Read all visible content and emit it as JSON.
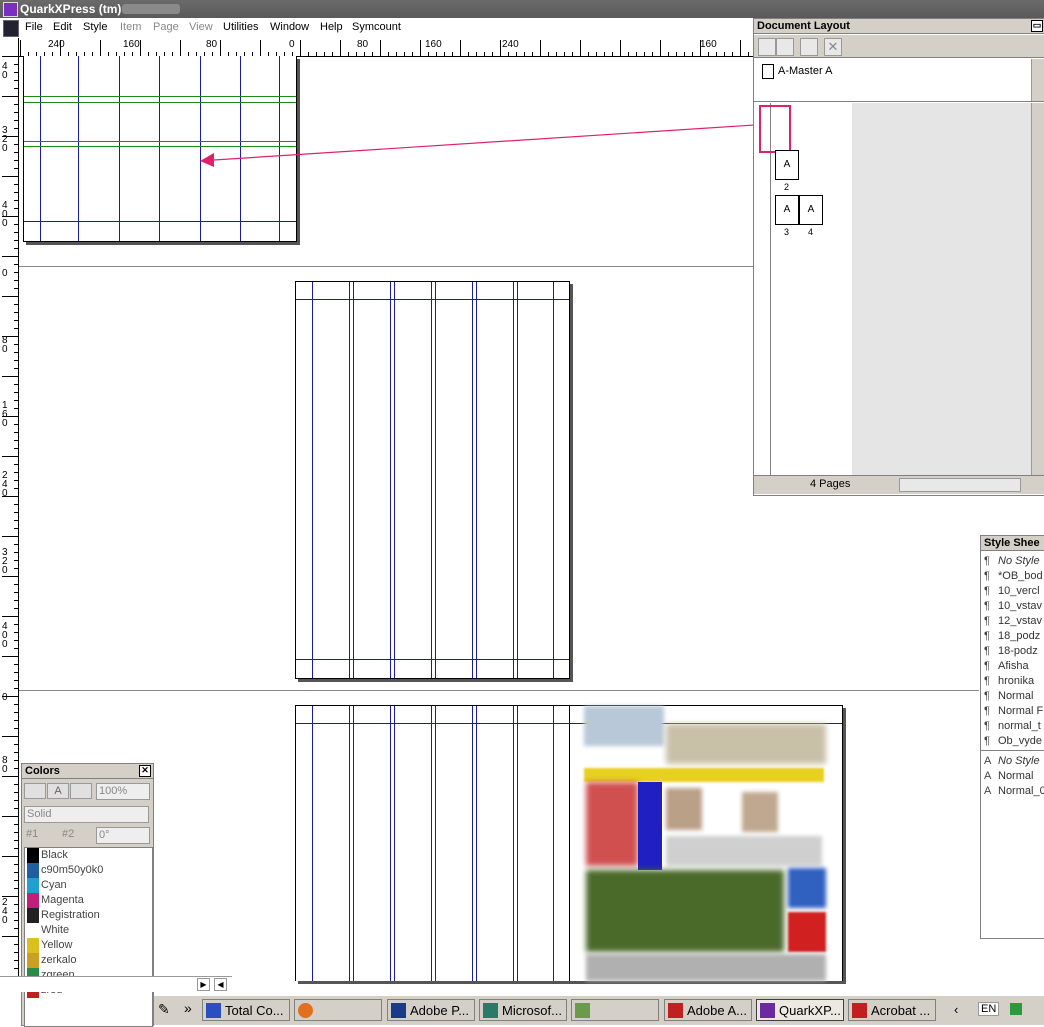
{
  "app": {
    "title": "QuarkXPress (tm)"
  },
  "menu": [
    "File",
    "Edit",
    "Style",
    "Item",
    "Page",
    "View",
    "Utilities",
    "Window",
    "Help",
    "Symcount"
  ],
  "ruler": {
    "h_labels": [
      "240",
      "160",
      "80",
      "0",
      "80",
      "160",
      "240",
      "160"
    ],
    "v_labels": [
      "4\n0",
      "3\n2\n0",
      "4\n0\n0",
      "0",
      "8\n0",
      "1\n6\n0",
      "2\n4\n0",
      "3\n2\n0",
      "4\n0\n0",
      "0",
      "8\n0",
      "2\n4\n0"
    ]
  },
  "document_layout": {
    "title": "Document Layout",
    "master": "A-Master A",
    "pages": [
      {
        "label": "A",
        "num": "2"
      },
      {
        "label": "A",
        "num": "3"
      },
      {
        "label": "A",
        "num": "4"
      }
    ],
    "page_count": "4 Pages"
  },
  "style_sheets": {
    "title": "Style Shee",
    "paragraph": [
      "No Style",
      "*OB_bod",
      "10_vercl",
      "10_vstav",
      "12_vstav",
      "18_podz",
      "18-podz",
      "Afisha",
      "hronika",
      "Normal",
      "Normal F",
      "normal_t",
      "Ob_vyde"
    ],
    "character": [
      "No Style",
      "Normal",
      "Normal_0"
    ]
  },
  "colors": {
    "title": "Colors",
    "opacity": "100%",
    "fill": "Solid",
    "radio1": "#1",
    "radio2": "#2",
    "angle": "0°",
    "items": [
      {
        "name": "Black",
        "color": "#000000"
      },
      {
        "name": "c90m50y0k0",
        "color": "#1f5fa0"
      },
      {
        "name": "Cyan",
        "color": "#1fa0d0"
      },
      {
        "name": "Magenta",
        "color": "#c0207a"
      },
      {
        "name": "Registration",
        "color": "#222222"
      },
      {
        "name": "White",
        "color": "#ffffff"
      },
      {
        "name": "Yellow",
        "color": "#d8c020"
      },
      {
        "name": "zerkalo",
        "color": "#c9a020"
      },
      {
        "name": "zgreen",
        "color": "#2a8a4a"
      },
      {
        "name": "zred",
        "color": "#c02020"
      }
    ]
  },
  "taskbar": {
    "items": [
      "Total Co...",
      "Adobe P...",
      "Microsof...",
      "Adobe A...",
      "QuarkXP...",
      "Acrobat ..."
    ],
    "lang": "EN"
  },
  "accent": {
    "magenta": "#e0206a",
    "guide_blue": "#1a1ab0",
    "guide_green": "#1a8a1a"
  }
}
